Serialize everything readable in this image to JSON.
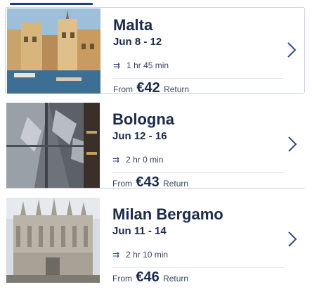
{
  "cards": [
    {
      "city": "Malta",
      "dates": "Jun 8 - 12",
      "duration": "1 hr 45 min",
      "from_label": "From",
      "price": "€42",
      "trip_type": "Return",
      "image_icon": "malta-photo",
      "duration_icon": "flight-duration-icon",
      "chevron_icon": "chevron-right-icon"
    },
    {
      "city": "Bologna",
      "dates": "Jun 12 - 16",
      "duration": "2 hr 0 min",
      "from_label": "From",
      "price": "€43",
      "trip_type": "Return",
      "image_icon": "bologna-photo",
      "duration_icon": "flight-duration-icon",
      "chevron_icon": "chevron-right-icon"
    },
    {
      "city": "Milan Bergamo",
      "dates": "Jun 11 - 14",
      "duration": "2 hr 10 min",
      "from_label": "From",
      "price": "€46",
      "trip_type": "Return",
      "image_icon": "milan-bergamo-photo",
      "duration_icon": "flight-duration-icon",
      "chevron_icon": "chevron-right-icon"
    }
  ],
  "colors": {
    "text_primary": "#1c2b4a",
    "border": "#c9d1e0",
    "accent": "#2f4a8a"
  }
}
